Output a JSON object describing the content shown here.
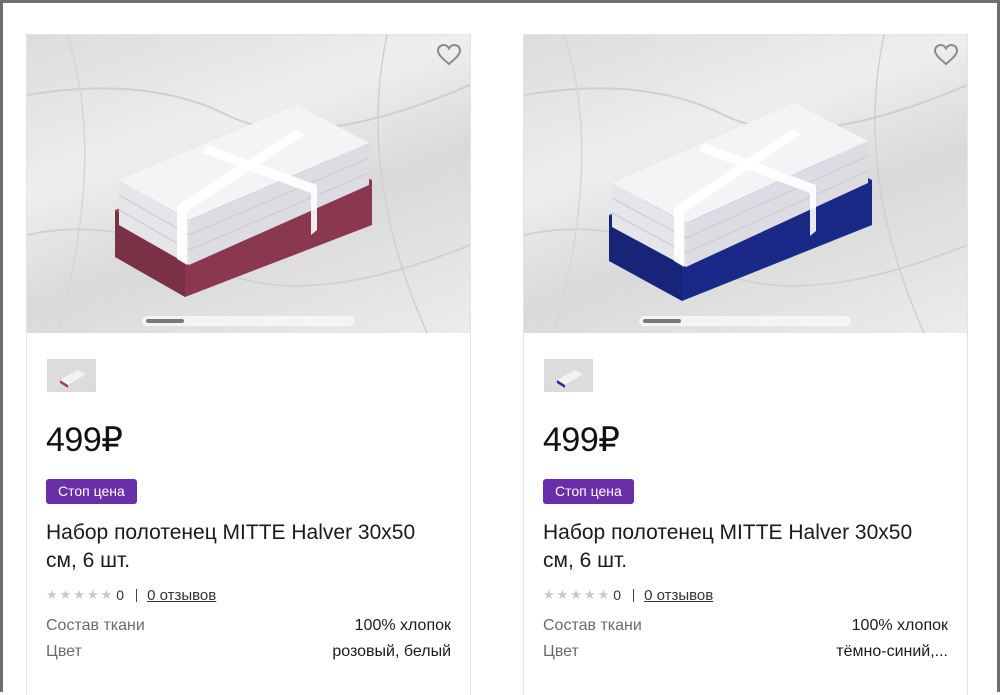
{
  "products": [
    {
      "price": "499₽",
      "badge": "Стоп цена",
      "title": "Набор полотенец MITTE Halver 30х50 см, 6 шт.",
      "rating_stars": "★★★★★",
      "rating_value": "0",
      "reviews_link": "0 отзывов",
      "specs": [
        {
          "label": "Состав ткани",
          "value": "100% хлопок"
        },
        {
          "label": "Цвет",
          "value": "розовый, белый"
        }
      ],
      "towel_color": "#9b4259",
      "towel_color_dark": "#7a3045",
      "icons": {
        "favorite": "heart-icon"
      }
    },
    {
      "price": "499₽",
      "badge": "Стоп цена",
      "title": "Набор полотенец MITTE Halver 30х50 см, 6 шт.",
      "rating_stars": "★★★★★",
      "rating_value": "0",
      "reviews_link": "0 отзывов",
      "specs": [
        {
          "label": "Состав ткани",
          "value": "100% хлопок"
        },
        {
          "label": "Цвет",
          "value": "тёмно-синий,..."
        }
      ],
      "towel_color": "#1f2f9e",
      "towel_color_dark": "#172478",
      "icons": {
        "favorite": "heart-icon"
      }
    }
  ],
  "colors": {
    "badge_bg": "#6a2ea8",
    "frame": "#6f6f6f"
  }
}
